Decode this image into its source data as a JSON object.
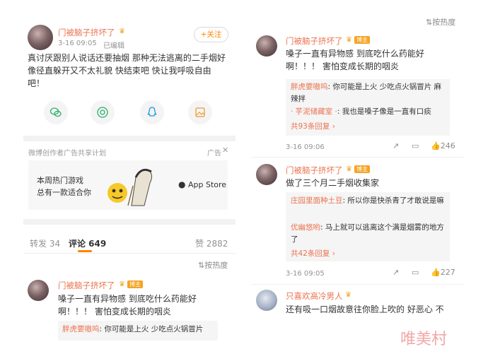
{
  "left_post": {
    "author": "门被脑子挤坏了",
    "time": "3-16 09:05",
    "edited": "已编辑",
    "follow_label": "+关注",
    "body": "真讨厌跟别人说话还要抽烟 那种无法逃离的二手烟好像径直躲开又不太礼貌 快结束吧 快让我呼吸自由吧！",
    "share_icons": [
      "wechat-icon",
      "moments-icon",
      "qq-icon",
      "image-icon"
    ],
    "ad": {
      "label": "微博创作者广告共享计划",
      "tag": "广告",
      "line1": "本周热门游戏",
      "line2": "总有一款适合你",
      "store": "App Store"
    },
    "tabs": {
      "repost": "转发 34",
      "comment": "评论 649",
      "like": "赞 2882"
    },
    "sort_label": "按热度",
    "first_comment": {
      "author": "门被脑子挤坏了",
      "text": "嗓子一直有异物感 到底吃什么药能好啊！！！ 害怕变成长期的咽炎",
      "reply_user": "胖虎要嗷呜",
      "reply_text": ": 你可能是上火 少吃点火锅冒片"
    }
  },
  "right_panel": {
    "sort_label": "按热度",
    "comments": [
      {
        "author": "门被脑子挤坏了",
        "badge": "博主",
        "text": "嗓子一直有异物感 到底吃什么药能好啊！！！ 害怕变成长期的咽炎",
        "replies": [
          {
            "user": "胖虎要嗷呜",
            "text": ": 你可能是上火 少吃点火锅冒片 麻辣拌"
          },
          {
            "user": "· 芋泥储藏室 ·",
            "text": ": 我也是嗓子像是一直有口痰"
          }
        ],
        "reply_count": "共93条回复",
        "time": "3-16 09:06",
        "likes": "246"
      },
      {
        "author": "门被脑子挤坏了",
        "badge": "博主",
        "text": "做了三个月二手烟收集家",
        "replies": [
          {
            "user": "庄园里面种土豆",
            "text": ": 所以你是快杀青了才敢说是嘛"
          },
          {
            "user": "优幽悠哟",
            "text": ": 马上就可以逃离这个满是烟雾的地方了"
          }
        ],
        "reply_count": "共42条回复",
        "time": "3-16 09:05",
        "likes": "227"
      },
      {
        "author": "只喜欢高冷男人",
        "text": "还有吸一口烟故意往你脸上吹的 好恶心 不"
      }
    ]
  },
  "watermark": "唯美村",
  "colors": {
    "accent": "#eb7350",
    "orange": "#ff8200",
    "vip": "#f5a323"
  }
}
